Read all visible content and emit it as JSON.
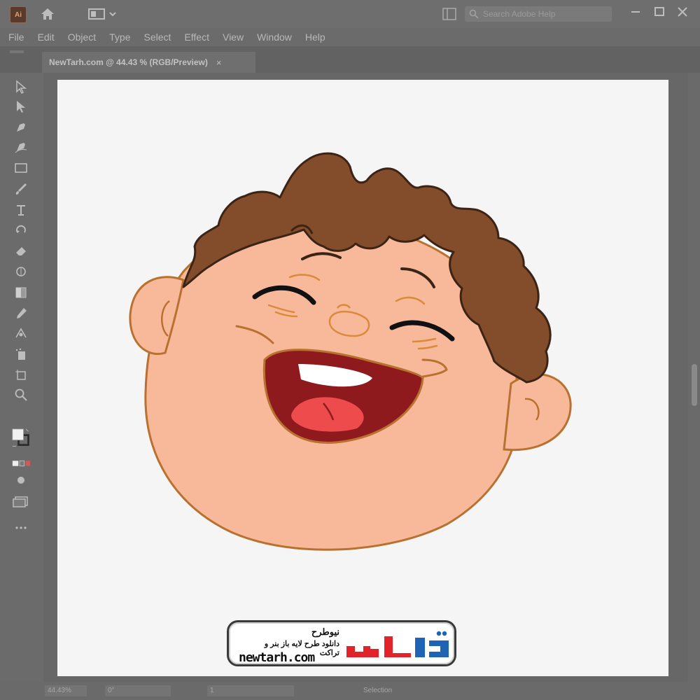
{
  "app": {
    "logo_text": "Ai",
    "search_placeholder": "Search Adobe Help"
  },
  "menu": {
    "items": [
      "File",
      "Edit",
      "Object",
      "Type",
      "Select",
      "Effect",
      "View",
      "Window",
      "Help"
    ]
  },
  "document": {
    "tab_title": "NewTarh.com @ 44.43 % (RGB/Preview)",
    "close_glyph": "×"
  },
  "status": {
    "zoom": "44.43%",
    "rotation": "0°",
    "artboard": "1",
    "tool": "Selection"
  },
  "watermark": {
    "brand_fa": "نیوطرح",
    "tagline_fa": "دانلود طرح لایه باز بنر و تراکت",
    "url": "newtarh.com"
  },
  "colors": {
    "ui_gray": "#6b6b6b",
    "artboard": "#f5f5f6",
    "skin": "#f8b99b",
    "hair": "#834c2b",
    "mouth": "#8f1a1e",
    "tongue": "#ee4b4c",
    "brand_red": "#e2242a",
    "brand_blue": "#1e63b6"
  },
  "tools": [
    "selection-icon",
    "direct-selection-icon",
    "pen-icon",
    "curvature-icon",
    "rectangle-icon",
    "paintbrush-icon",
    "type-icon",
    "rotate-icon",
    "eraser-icon",
    "shape-builder-icon",
    "gradient-icon",
    "eyedropper-icon",
    "blend-icon",
    "symbol-sprayer-icon",
    "artboard-icon",
    "zoom-icon",
    "fill-stroke-icon",
    "color-mode-icon",
    "draw-mode-icon",
    "screen-mode-icon",
    "more-tools-icon"
  ]
}
